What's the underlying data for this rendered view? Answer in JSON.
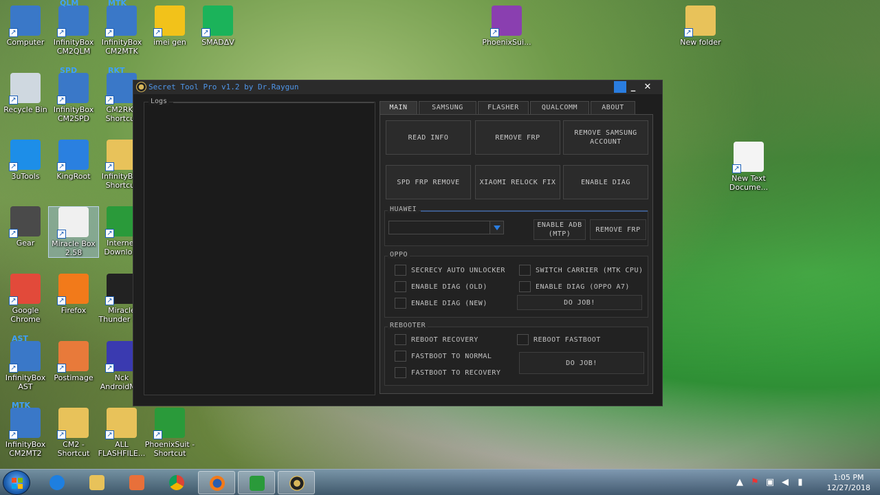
{
  "desktop": {
    "icons": [
      {
        "label": "Computer",
        "color": "#3a78c8"
      },
      {
        "label": "InfinityBox\nCM2QLM",
        "brand": "QLM",
        "color": "#3a78c8"
      },
      {
        "label": "InfinityBox\nCM2MTK",
        "brand": "MTK",
        "color": "#3a78c8"
      },
      {
        "label": "imei gen",
        "color": "#f2c21a"
      },
      {
        "label": "SMADΔV",
        "color": "#1bb35a"
      },
      {
        "label": "PhoenixSui...",
        "color": "#8a3fb0"
      },
      {
        "label": "New folder",
        "color": "#e8c25a"
      },
      {
        "label": "Recycle Bin",
        "color": "#cfd8e0"
      },
      {
        "label": "InfinityBox\nCM2SPD",
        "brand": "SPD",
        "color": "#3a78c8"
      },
      {
        "label": "CM2RKT\nShortcut",
        "brand": "RKT",
        "color": "#3a78c8"
      },
      {
        "label": "New Text\nDocume...",
        "color": "#f4f4f4"
      },
      {
        "label": "3uTools",
        "color": "#1d8ee8"
      },
      {
        "label": "KingRoot",
        "color": "#2a80e0"
      },
      {
        "label": "InfinityBox\nShortcut",
        "color": "#e8c25a"
      },
      {
        "label": "Gear",
        "color": "#4a4a4a"
      },
      {
        "label": "Miracle Box\n2.58",
        "color": "#f0f0f0"
      },
      {
        "label": "Internet\nDownlo...",
        "color": "#2a9a3a"
      },
      {
        "label": "Google\nChrome",
        "color": "#e24a3a"
      },
      {
        "label": "Firefox",
        "color": "#f27a1a"
      },
      {
        "label": "Miracle\nThunder 2...",
        "color": "#222222"
      },
      {
        "label": "InfinityBox\nAST",
        "brand": "AST",
        "color": "#3a78c8"
      },
      {
        "label": "Postimage",
        "color": "#e87a3a"
      },
      {
        "label": "Nck\nAndroidM...",
        "color": "#3a3ab0"
      },
      {
        "label": "InfinityBox\nCM2MT2",
        "brand": "MTK",
        "color": "#3a78c8"
      },
      {
        "label": "CM2 -\nShortcut",
        "color": "#e8c25a"
      },
      {
        "label": "ALL\nFLASHFILE...",
        "color": "#e8c25a"
      },
      {
        "label": "PhoenixSuit -\nShortcut",
        "color": "#2a9a3a"
      }
    ]
  },
  "window": {
    "title": "Secret Tool Pro v1.2 by Dr.Raygun",
    "minimize": "_",
    "close": "✕",
    "accent": "#2a7de0"
  },
  "logs": {
    "label": "Logs"
  },
  "tabs": [
    "MAIN",
    "SAMSUNG",
    "FLASHER",
    "QUALCOMM",
    "ABOUT"
  ],
  "main": {
    "read_info": "READ INFO",
    "remove_frp": "REMOVE FRP",
    "remove_samsung_account": "REMOVE SAMSUNG ACCOUNT",
    "spd_frp_remove": "SPD FRP REMOVE",
    "xiaomi_relock_fix": "XIAOMI RELOCK FIX",
    "enable_diag": "ENABLE DIAG"
  },
  "huawei": {
    "title": "HUAWEI",
    "select_value": "",
    "enable_adb": "ENABLE ADB (MTP)",
    "remove_frp": "REMOVE FRP"
  },
  "oppo": {
    "title": "OPPO",
    "secrecy_auto_unlocker": "SECRECY AUTO UNLOCKER",
    "switch_carrier": "SWITCH CARRIER (MTK CPU)",
    "enable_diag_old": "ENABLE DIAG (OLD)",
    "enable_diag_oppo_a7": "ENABLE DIAG (OPPO A7)",
    "enable_diag_new": "ENABLE DIAG (NEW)",
    "do_job": "DO JOB!"
  },
  "rebooter": {
    "title": "REBOOTER",
    "reboot_recovery": "REBOOT RECOVERY",
    "reboot_fastboot": "REBOOT FASTBOOT",
    "fastboot_to_normal": "FASTBOOT TO NORMAL",
    "fastboot_to_recovery": "FASTBOOT TO RECOVERY",
    "do_job": "DO JOB!"
  },
  "taskbar": {
    "time": "1:05 PM",
    "date": "12/27/2018"
  }
}
